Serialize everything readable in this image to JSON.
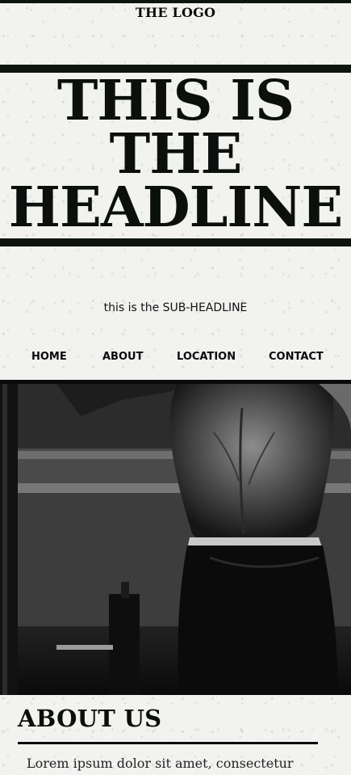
{
  "header": {
    "logo": "THE LOGO",
    "headline_lines": [
      "THIS IS",
      "THE",
      "HEADLINE"
    ],
    "subheadline": "this is the SUB-HEADLINE"
  },
  "nav": {
    "items": [
      {
        "label": "HOME"
      },
      {
        "label": "ABOUT"
      },
      {
        "label": "LOCATION"
      },
      {
        "label": "CONTACT"
      }
    ]
  },
  "hero": {
    "image": "black-and-white photo of a muscular man's back in a gym"
  },
  "about": {
    "title": "ABOUT US",
    "body": "Lorem ipsum dolor sit amet, consectetur"
  },
  "colors": {
    "ink": "#0d140f",
    "paper": "#f3f3f1"
  }
}
